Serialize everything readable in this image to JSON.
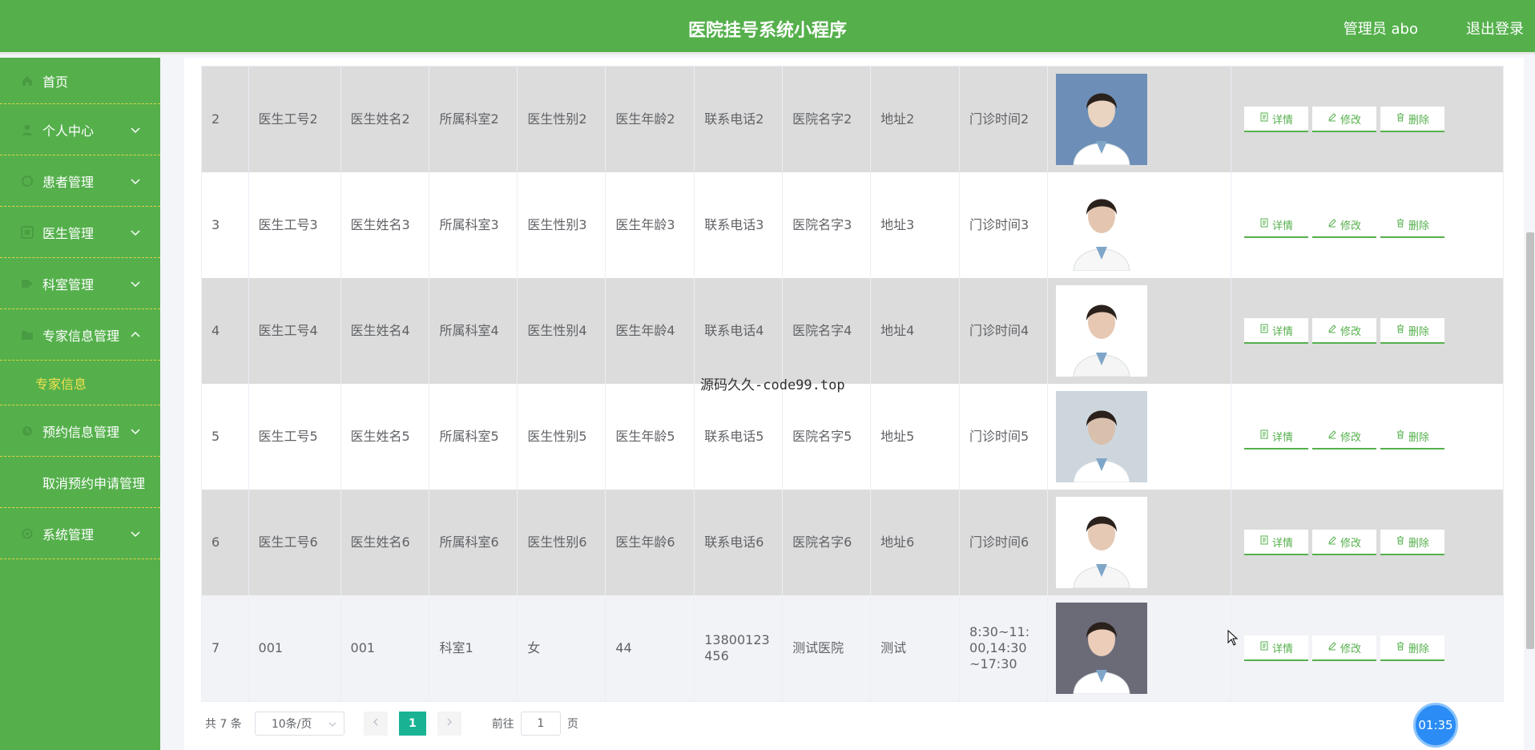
{
  "header": {
    "title": "医院挂号系统小程序",
    "admin": "管理员 abo",
    "logout": "退出登录"
  },
  "sidebar": {
    "items": [
      {
        "label": "首页",
        "icon": "home-icon"
      },
      {
        "label": "个人中心",
        "icon": "user-icon",
        "expanded": false
      },
      {
        "label": "患者管理",
        "icon": "circle-icon",
        "expanded": false
      },
      {
        "label": "医生管理",
        "icon": "grid-icon",
        "expanded": false
      },
      {
        "label": "科室管理",
        "icon": "tag-icon",
        "expanded": false
      },
      {
        "label": "专家信息管理",
        "icon": "folder-icon",
        "expanded": true
      },
      {
        "label": "预约信息管理",
        "icon": "clock-icon",
        "expanded": false
      },
      {
        "label": "取消预约申请管理",
        "icon": "",
        "expanded": false
      },
      {
        "label": "系统管理",
        "icon": "settings-icon",
        "expanded": false
      }
    ],
    "submenu": {
      "label": "专家信息"
    }
  },
  "table": {
    "rows": [
      {
        "index": "2",
        "doctor_id": "医生工号2",
        "name": "医生姓名2",
        "dept": "所属科室2",
        "gender": "医生性别2",
        "age": "医生年龄2",
        "phone": "联系电话2",
        "hospital": "医院名字2",
        "address": "地址2",
        "hours": "门诊时间2"
      },
      {
        "index": "3",
        "doctor_id": "医生工号3",
        "name": "医生姓名3",
        "dept": "所属科室3",
        "gender": "医生性别3",
        "age": "医生年龄3",
        "phone": "联系电话3",
        "hospital": "医院名字3",
        "address": "地址3",
        "hours": "门诊时间3"
      },
      {
        "index": "4",
        "doctor_id": "医生工号4",
        "name": "医生姓名4",
        "dept": "所属科室4",
        "gender": "医生性别4",
        "age": "医生年龄4",
        "phone": "联系电话4",
        "hospital": "医院名字4",
        "address": "地址4",
        "hours": "门诊时间4"
      },
      {
        "index": "5",
        "doctor_id": "医生工号5",
        "name": "医生姓名5",
        "dept": "所属科室5",
        "gender": "医生性别5",
        "age": "医生年龄5",
        "phone": "联系电话5",
        "hospital": "医院名字5",
        "address": "地址5",
        "hours": "门诊时间5"
      },
      {
        "index": "6",
        "doctor_id": "医生工号6",
        "name": "医生姓名6",
        "dept": "所属科室6",
        "gender": "医生性别6",
        "age": "医生年龄6",
        "phone": "联系电话6",
        "hospital": "医院名字6",
        "address": "地址6",
        "hours": "门诊时间6"
      },
      {
        "index": "7",
        "doctor_id": "001",
        "name": "001",
        "dept": "科室1",
        "gender": "女",
        "age": "44",
        "phone": "13800123456",
        "hospital": "测试医院",
        "address": "测试",
        "hours": "8:30~11:00,14:30~17:30"
      }
    ],
    "actions": {
      "detail": "详情",
      "edit": "修改",
      "delete": "删除"
    }
  },
  "pagination": {
    "total": "共 7 条",
    "page_size": "10条/页",
    "current_page": "1",
    "goto_label": "前往",
    "goto_value": "1",
    "page_unit": "页"
  },
  "overlay": {
    "watermark": "源码久久-code99.top",
    "timer": "01:35"
  },
  "colors": {
    "primary": "#55b04c",
    "accent": "#f0e24d",
    "page_active": "#19b394",
    "timer": "#2b8cf5"
  }
}
